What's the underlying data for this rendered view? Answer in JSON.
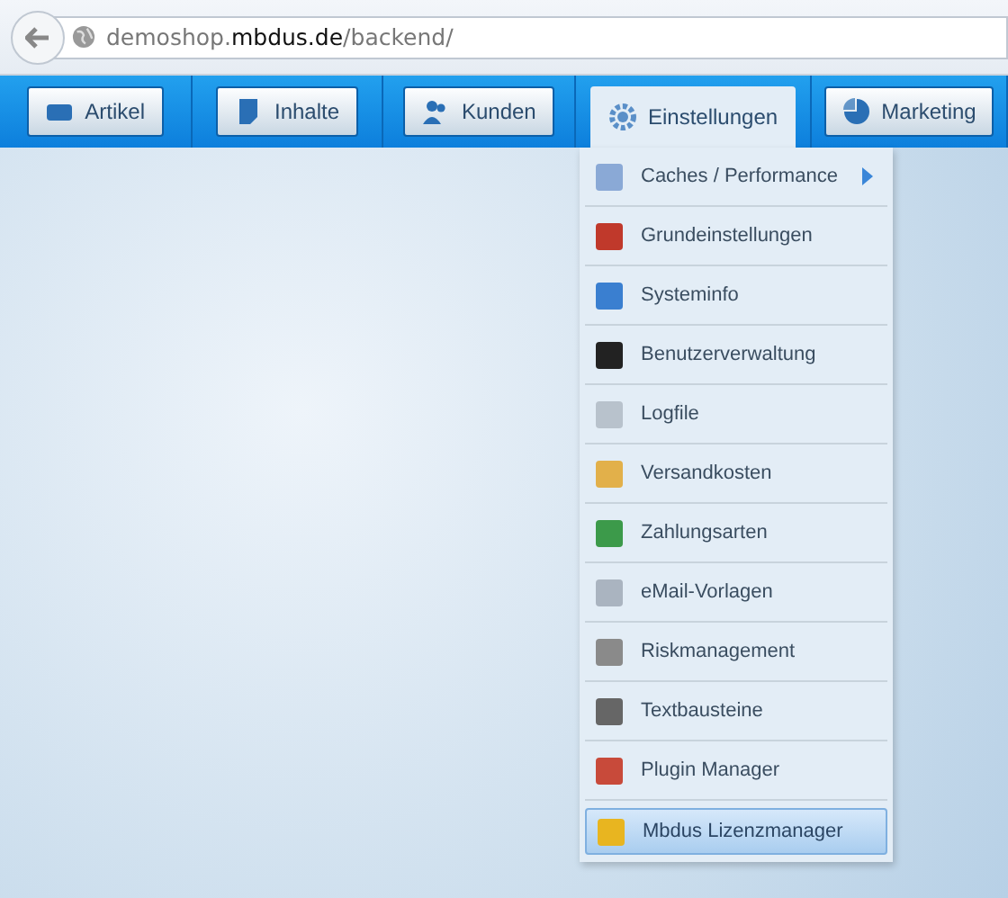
{
  "browser": {
    "url": "demoshop.**mbdus.de**/backend/"
  },
  "nav": [
    {
      "label": "Artikel",
      "selected": false
    },
    {
      "label": "Inhalte",
      "selected": false
    },
    {
      "label": "Kunden",
      "selected": false
    },
    {
      "label": "Einstellungen",
      "selected": true
    },
    {
      "label": "Marketing",
      "selected": false
    }
  ],
  "menu": [
    {
      "label": "Caches / Performance",
      "submenu": true,
      "selected": false
    },
    {
      "label": "Grundeinstellungen",
      "submenu": false,
      "selected": false
    },
    {
      "label": "Systeminfo",
      "submenu": false,
      "selected": false
    },
    {
      "label": "Benutzerverwaltung",
      "submenu": false,
      "selected": false
    },
    {
      "label": "Logfile",
      "submenu": false,
      "selected": false
    },
    {
      "label": "Versandkosten",
      "submenu": false,
      "selected": false
    },
    {
      "label": "Zahlungsarten",
      "submenu": false,
      "selected": false
    },
    {
      "label": "eMail-Vorlagen",
      "submenu": false,
      "selected": false
    },
    {
      "label": "Riskmanagement",
      "submenu": false,
      "selected": false
    },
    {
      "label": "Textbausteine",
      "submenu": false,
      "selected": false
    },
    {
      "label": "Plugin Manager",
      "submenu": false,
      "selected": false
    },
    {
      "label": "Mbdus Lizenzmanager",
      "submenu": false,
      "selected": true
    }
  ]
}
